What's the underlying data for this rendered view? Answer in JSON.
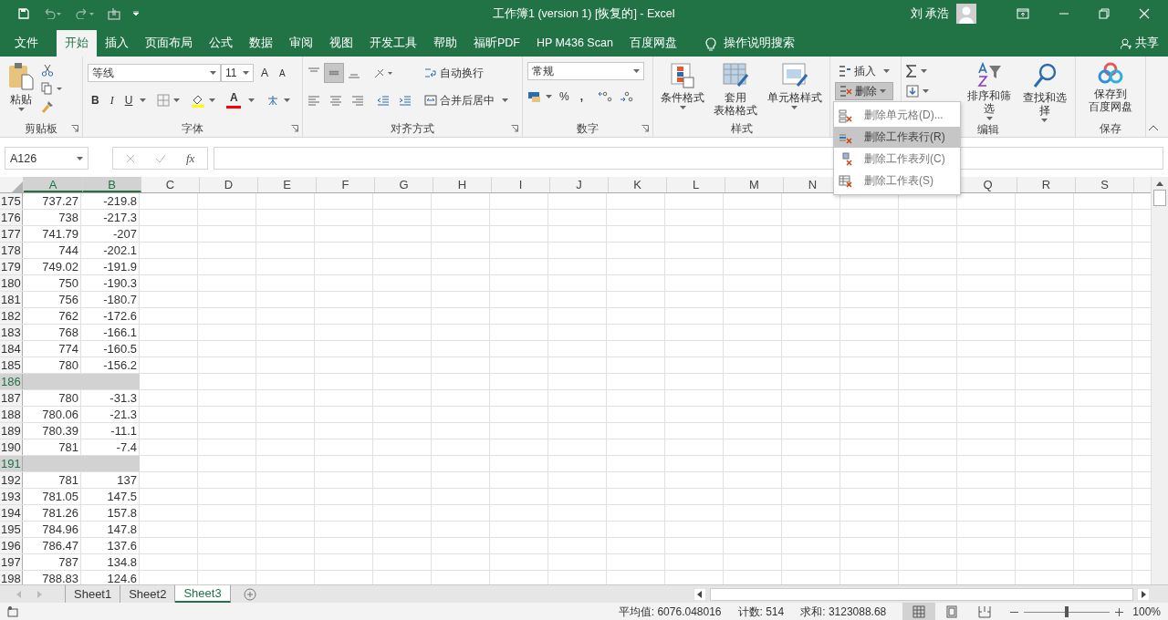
{
  "title_bar": {
    "title": "工作簿1 (version 1) [恢复的]  -  Excel",
    "user": "刘 承浩"
  },
  "ribbon_tabs": [
    {
      "label": "文件",
      "selected": false
    },
    {
      "label": "开始",
      "selected": true
    },
    {
      "label": "插入",
      "selected": false
    },
    {
      "label": "页面布局",
      "selected": false
    },
    {
      "label": "公式",
      "selected": false
    },
    {
      "label": "数据",
      "selected": false
    },
    {
      "label": "审阅",
      "selected": false
    },
    {
      "label": "视图",
      "selected": false
    },
    {
      "label": "开发工具",
      "selected": false
    },
    {
      "label": "帮助",
      "selected": false
    },
    {
      "label": "福昕PDF",
      "selected": false
    },
    {
      "label": "HP M436 Scan",
      "selected": false
    },
    {
      "label": "百度网盘",
      "selected": false
    }
  ],
  "tell_me": "操作说明搜索",
  "share": "共享",
  "clipboard": {
    "label": "剪贴板",
    "paste": "粘贴"
  },
  "font": {
    "label": "字体",
    "font_name": "等线",
    "font_size": "11",
    "grow": "A",
    "shrink": "A",
    "bold": "B",
    "italic": "I",
    "underline": "U",
    "font_color": "A"
  },
  "alignment": {
    "label": "对齐方式",
    "middle_selected": true,
    "wrap_text": "自动换行",
    "merge_center": "合并后居中"
  },
  "number": {
    "label": "数字",
    "format": "常规",
    "percent": "%",
    "comma": ","
  },
  "styles": {
    "label": "样式",
    "conditional": "条件格式",
    "table_format": [
      "套用",
      "表格格式"
    ],
    "cell_styles": "单元格样式"
  },
  "cells": {
    "insert": "插入",
    "delete": "删除",
    "delete_pressed": true
  },
  "editing": {
    "label": "编辑",
    "sort_filter": "排序和筛选",
    "find_select": "查找和选择"
  },
  "save": {
    "label": "保存",
    "save_to": [
      "保存到",
      "百度网盘"
    ]
  },
  "delete_menu": [
    {
      "label": "删除单元格(D)...",
      "selected": false,
      "kind": "cells"
    },
    {
      "label": "删除工作表行(R)",
      "selected": true,
      "kind": "rows"
    },
    {
      "label": "删除工作表列(C)",
      "selected": false,
      "kind": "columns"
    },
    {
      "label": "删除工作表(S)",
      "selected": false,
      "kind": "sheet"
    }
  ],
  "formula_bar": {
    "name_box": "A126",
    "fx": "fx"
  },
  "columns": [
    {
      "label": "A",
      "selected": true
    },
    {
      "label": "B",
      "selected": true
    },
    {
      "label": "C",
      "selected": false
    },
    {
      "label": "D",
      "selected": false
    },
    {
      "label": "E",
      "selected": false
    },
    {
      "label": "F",
      "selected": false
    },
    {
      "label": "G",
      "selected": false
    },
    {
      "label": "H",
      "selected": false
    },
    {
      "label": "I",
      "selected": false
    },
    {
      "label": "J",
      "selected": false
    },
    {
      "label": "K",
      "selected": false
    },
    {
      "label": "L",
      "selected": false
    },
    {
      "label": "M",
      "selected": false
    },
    {
      "label": "N",
      "selected": false
    },
    {},
    {},
    {
      "label": "Q",
      "selected": false
    },
    {
      "label": "R",
      "selected": false
    },
    {
      "label": "S",
      "selected": false
    }
  ],
  "rows": [
    {
      "number": "175",
      "a": "737.27",
      "b": "-219.8",
      "selected": false
    },
    {
      "number": "176",
      "a": "738",
      "b": "-217.3",
      "selected": false
    },
    {
      "number": "177",
      "a": "741.79",
      "b": "-207",
      "selected": false
    },
    {
      "number": "178",
      "a": "744",
      "b": "-202.1",
      "selected": false
    },
    {
      "number": "179",
      "a": "749.02",
      "b": "-191.9",
      "selected": false
    },
    {
      "number": "180",
      "a": "750",
      "b": "-190.3",
      "selected": false
    },
    {
      "number": "181",
      "a": "756",
      "b": "-180.7",
      "selected": false
    },
    {
      "number": "182",
      "a": "762",
      "b": "-172.6",
      "selected": false
    },
    {
      "number": "183",
      "a": "768",
      "b": "-166.1",
      "selected": false
    },
    {
      "number": "184",
      "a": "774",
      "b": "-160.5",
      "selected": false
    },
    {
      "number": "185",
      "a": "780",
      "b": "-156.2",
      "selected": false
    },
    {
      "number": "186",
      "selected": true
    },
    {
      "number": "187",
      "a": "780",
      "b": "-31.3",
      "selected": false
    },
    {
      "number": "188",
      "a": "780.06",
      "b": "-21.3",
      "selected": false
    },
    {
      "number": "189",
      "a": "780.39",
      "b": "-11.1",
      "selected": false
    },
    {
      "number": "190",
      "a": "781",
      "b": "-7.4",
      "selected": false
    },
    {
      "number": "191",
      "selected": true
    },
    {
      "number": "192",
      "a": "781",
      "b": "137",
      "selected": false
    },
    {
      "number": "193",
      "a": "781.05",
      "b": "147.5",
      "selected": false
    },
    {
      "number": "194",
      "a": "781.26",
      "b": "157.8",
      "selected": false
    },
    {
      "number": "195",
      "a": "784.96",
      "b": "147.8",
      "selected": false
    },
    {
      "number": "196",
      "a": "786.47",
      "b": "137.6",
      "selected": false
    },
    {
      "number": "197",
      "a": "787",
      "b": "134.8",
      "selected": false
    },
    {
      "number": "198",
      "a": "788.83",
      "b": "124.6",
      "selected": false
    }
  ],
  "sheets": [
    {
      "label": "Sheet1",
      "selected": false
    },
    {
      "label": "Sheet2",
      "selected": false
    },
    {
      "label": "Sheet3",
      "selected": true
    }
  ],
  "status_bar": {
    "average": "平均值: 6076.048016",
    "count": "计数: 514",
    "sum": "求和: 3123088.68",
    "views": [
      {
        "kind": "normal",
        "selected": true
      },
      {
        "kind": "page_layout",
        "selected": false
      },
      {
        "kind": "page_break",
        "selected": false
      }
    ],
    "zoom_slider": {
      "level": 0.5
    },
    "zoom": "100%"
  }
}
